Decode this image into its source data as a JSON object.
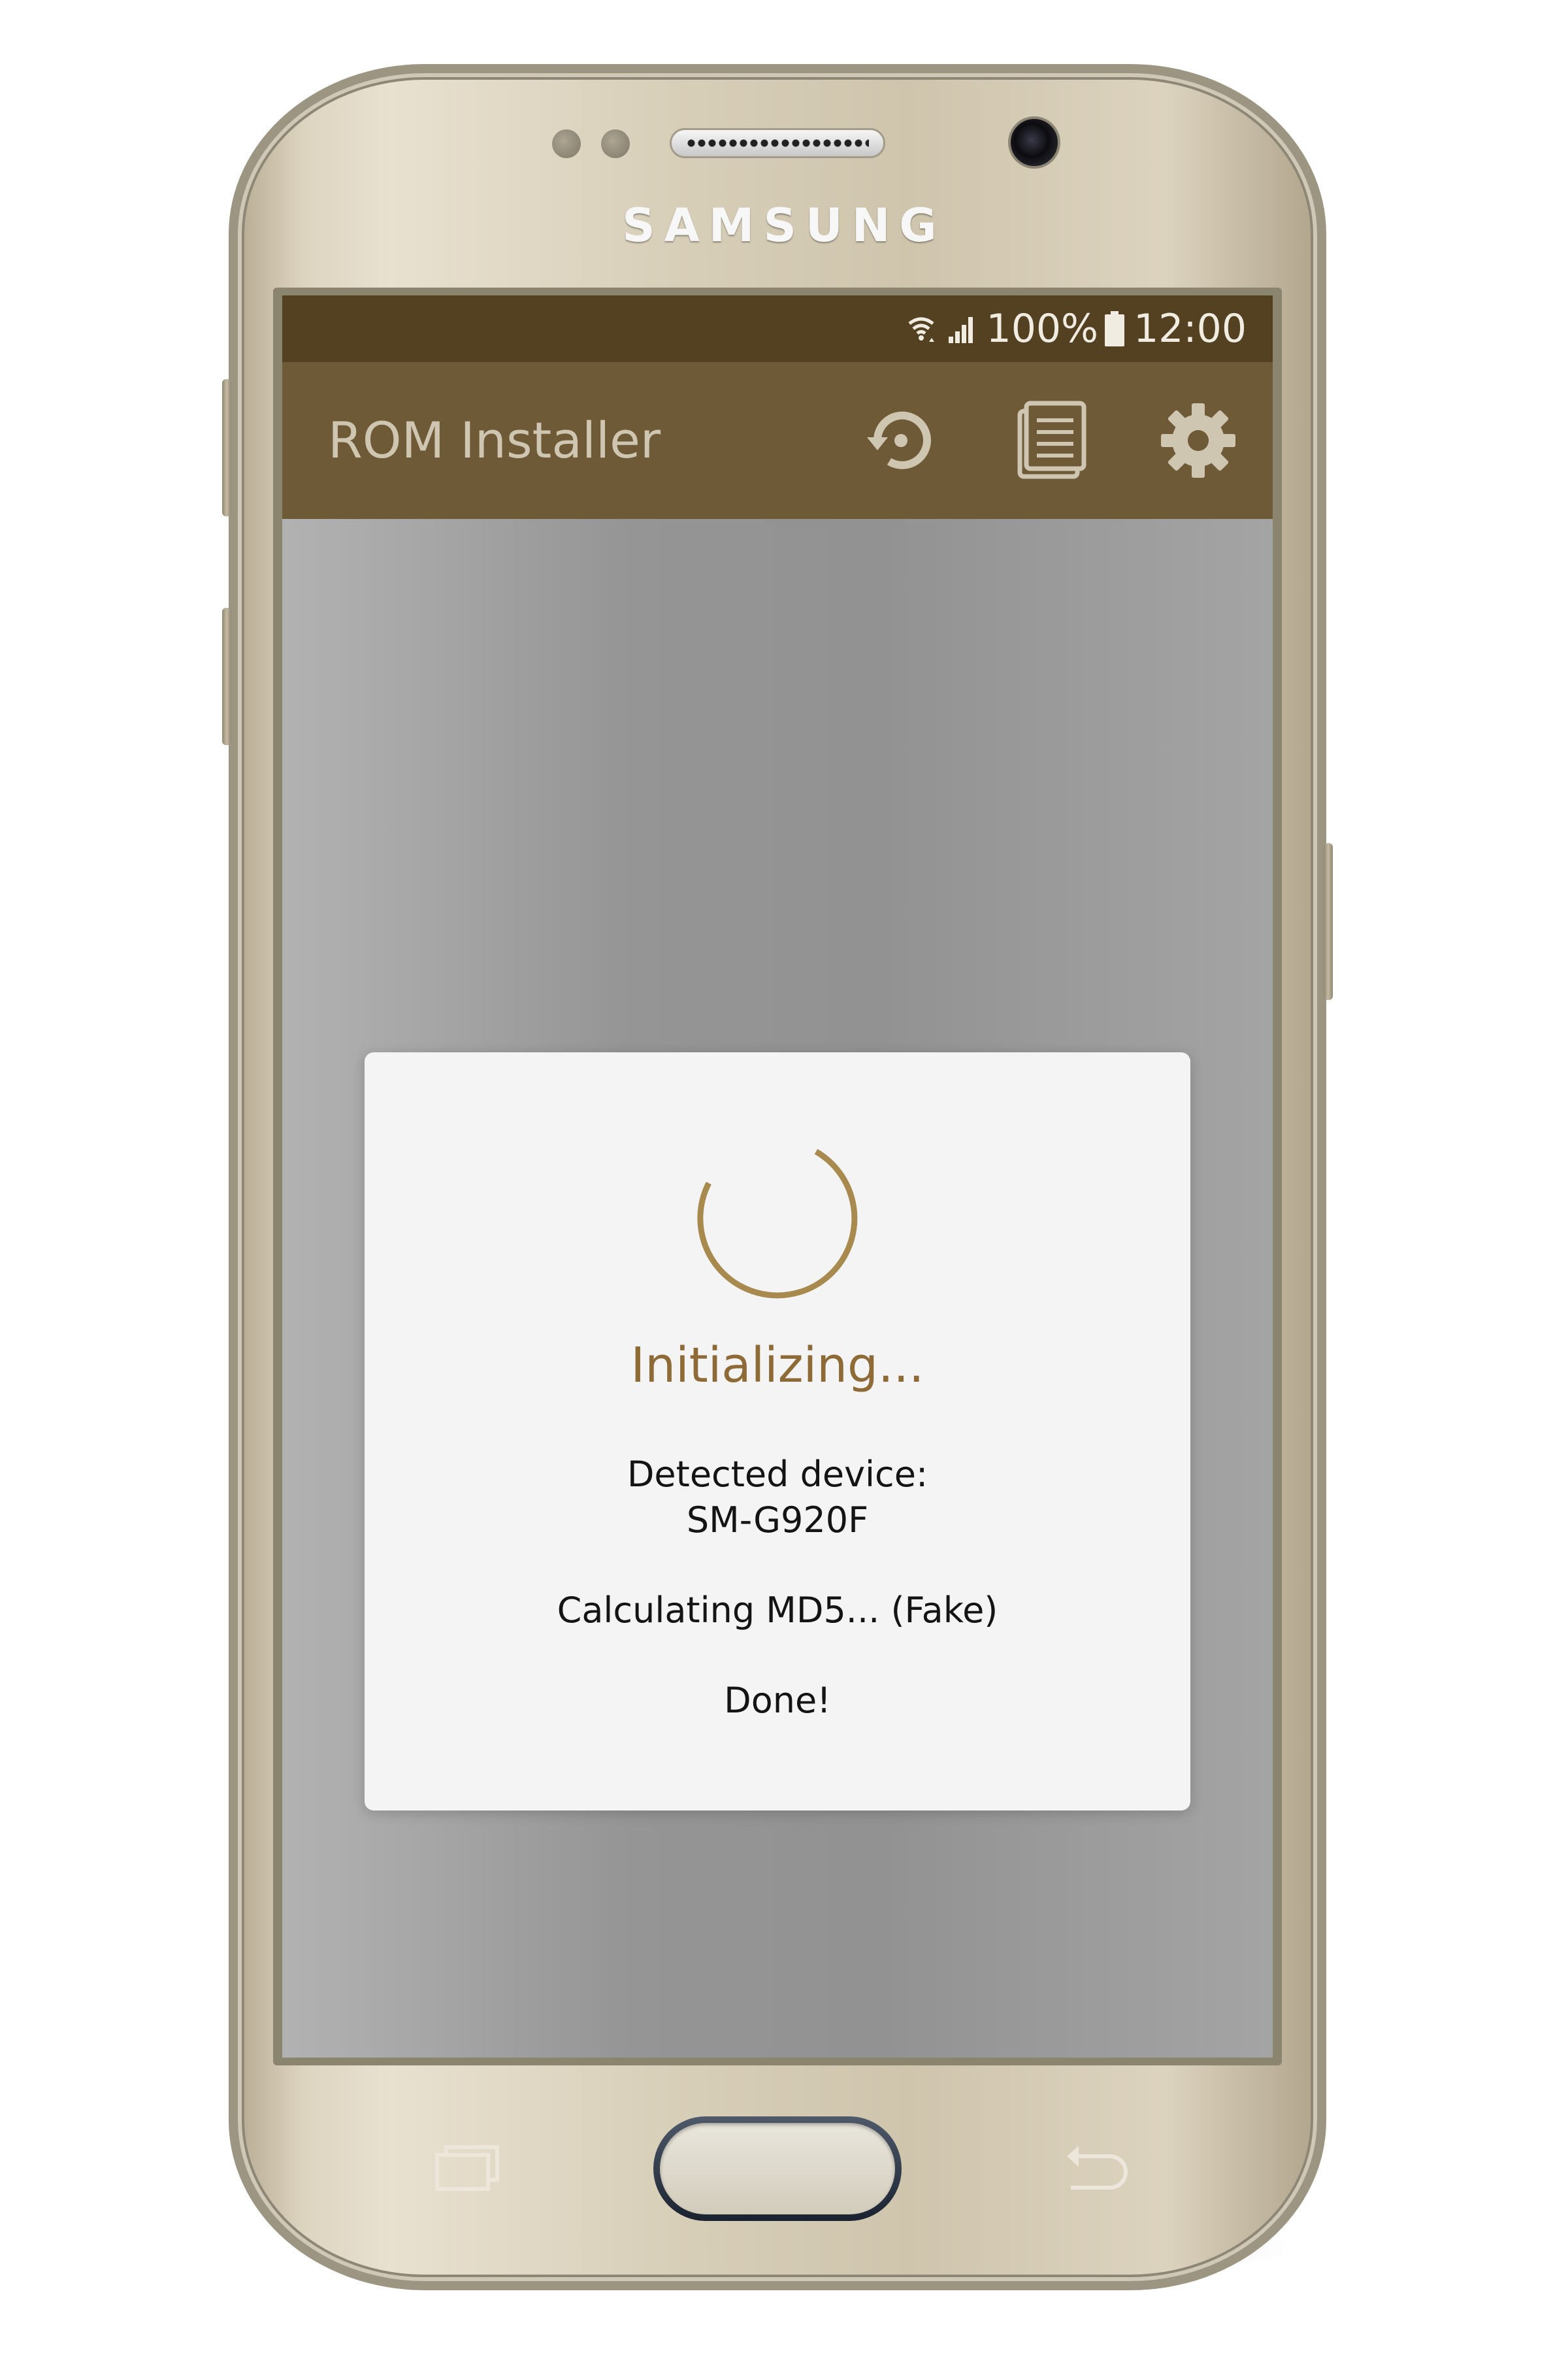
{
  "device": {
    "brand": "SAMSUNG"
  },
  "status_bar": {
    "battery": "100%",
    "time": "12:00",
    "icons": [
      "wifi-icon",
      "signal-icon",
      "battery-icon"
    ]
  },
  "app_bar": {
    "title": "ROM Installer",
    "actions": [
      "restore-icon",
      "log-icon",
      "settings-icon"
    ]
  },
  "dialog": {
    "title": "Initializing...",
    "device_label": "Detected device:",
    "device_model": "SM-G920F",
    "md5_status": "Calculating MD5... (Fake)",
    "done": "Done!"
  },
  "colors": {
    "status_bar": "#534121",
    "app_bar": "#6f5a37",
    "accent": "#a88a4f",
    "title_text": "#8e6a37"
  },
  "nav_keys": [
    "recents-icon",
    "back-icon"
  ]
}
